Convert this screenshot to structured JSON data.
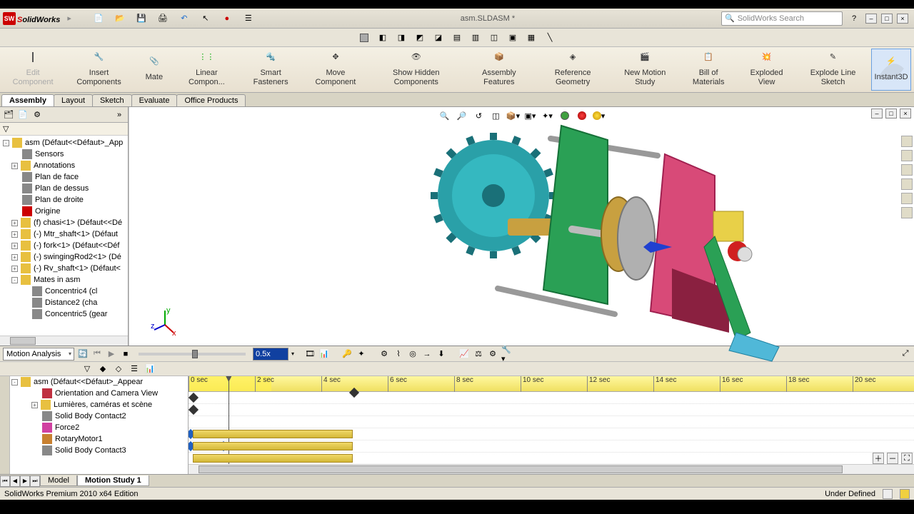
{
  "app": {
    "name_prefix": "S",
    "name_rest": "olidWorks"
  },
  "title": "asm.SLDASM *",
  "search_placeholder": "SolidWorks Search",
  "ribbon": [
    {
      "label": "Edit Component",
      "disabled": true
    },
    {
      "label": "Insert Components"
    },
    {
      "label": "Mate"
    },
    {
      "label": "Linear Compon..."
    },
    {
      "label": "Smart Fasteners"
    },
    {
      "label": "Move Component"
    },
    {
      "label": "Show Hidden Components"
    },
    {
      "label": "Assembly Features"
    },
    {
      "label": "Reference Geometry"
    },
    {
      "label": "New Motion Study"
    },
    {
      "label": "Bill of Materials"
    },
    {
      "label": "Exploded View"
    },
    {
      "label": "Explode Line Sketch"
    },
    {
      "label": "Instant3D",
      "active": true
    }
  ],
  "tabs": [
    {
      "label": "Assembly",
      "active": true
    },
    {
      "label": "Layout"
    },
    {
      "label": "Sketch"
    },
    {
      "label": "Evaluate"
    },
    {
      "label": "Office Products"
    }
  ],
  "tree": [
    {
      "label": "asm  (Défaut<<Défaut>_App",
      "depth": 0,
      "toggle": "-",
      "icon": "asm-icon"
    },
    {
      "label": "Sensors",
      "depth": 1,
      "icon": "sensor-icon"
    },
    {
      "label": "Annotations",
      "depth": 1,
      "toggle": "+",
      "icon": "annotation-icon"
    },
    {
      "label": "Plan de face",
      "depth": 1,
      "icon": "plane-icon"
    },
    {
      "label": "Plan de dessus",
      "depth": 1,
      "icon": "plane-icon"
    },
    {
      "label": "Plan de droite",
      "depth": 1,
      "icon": "plane-icon"
    },
    {
      "label": "Origine",
      "depth": 1,
      "icon": "origin-icon"
    },
    {
      "label": "(f) chasi<1> (Défaut<<Dé",
      "depth": 1,
      "toggle": "+",
      "icon": "part-icon"
    },
    {
      "label": "(-) Mtr_shaft<1> (Défaut",
      "depth": 1,
      "toggle": "+",
      "icon": "part-icon"
    },
    {
      "label": "(-) fork<1> (Défaut<<Déf",
      "depth": 1,
      "toggle": "+",
      "icon": "part-icon"
    },
    {
      "label": "(-) swingingRod2<1> (Dé",
      "depth": 1,
      "toggle": "+",
      "icon": "part-icon"
    },
    {
      "label": "(-) Rv_shaft<1> (Défaut<",
      "depth": 1,
      "toggle": "+",
      "icon": "part-icon"
    },
    {
      "label": "Mates in asm",
      "depth": 1,
      "toggle": "-",
      "icon": "mates-icon"
    },
    {
      "label": "Concentric4 (cl",
      "depth": 2,
      "icon": "mate-icon"
    },
    {
      "label": "Distance2 (cha",
      "depth": 2,
      "icon": "mate-icon"
    },
    {
      "label": "Concentric5 (gear",
      "depth": 2,
      "icon": "mate-icon"
    }
  ],
  "motion": {
    "study_type": "Motion Analysis",
    "speed": "0.5x",
    "time_labels": [
      "0 sec",
      "2 sec",
      "4 sec",
      "6 sec",
      "8 sec",
      "10 sec",
      "12 sec",
      "14 sec",
      "16 sec",
      "18 sec",
      "20 sec"
    ],
    "playhead_sec": 1.2,
    "end_sec": 2.5,
    "tree": [
      {
        "label": "asm  (Défaut<<Défaut>_Appear",
        "depth": 0,
        "toggle": "-",
        "icon": "asm-icon"
      },
      {
        "label": "Orientation and Camera View",
        "depth": 1,
        "icon": "camera-icon"
      },
      {
        "label": "Lumières, caméras et scène",
        "depth": 1,
        "toggle": "+",
        "icon": "light-icon"
      },
      {
        "label": "Solid Body Contact2",
        "depth": 1,
        "icon": "contact-icon"
      },
      {
        "label": "Force2",
        "depth": 1,
        "icon": "force-icon"
      },
      {
        "label": "RotaryMotor1",
        "depth": 1,
        "icon": "motor-icon"
      },
      {
        "label": "Solid Body Contact3",
        "depth": 1,
        "icon": "contact-icon"
      }
    ]
  },
  "bottom_tabs": [
    {
      "label": "Model"
    },
    {
      "label": "Motion Study 1",
      "active": true
    }
  ],
  "status": {
    "left": "SolidWorks Premium 2010 x64 Edition",
    "right": "Under Defined"
  },
  "triad": {
    "x": "x",
    "y": "y",
    "z": "z"
  }
}
